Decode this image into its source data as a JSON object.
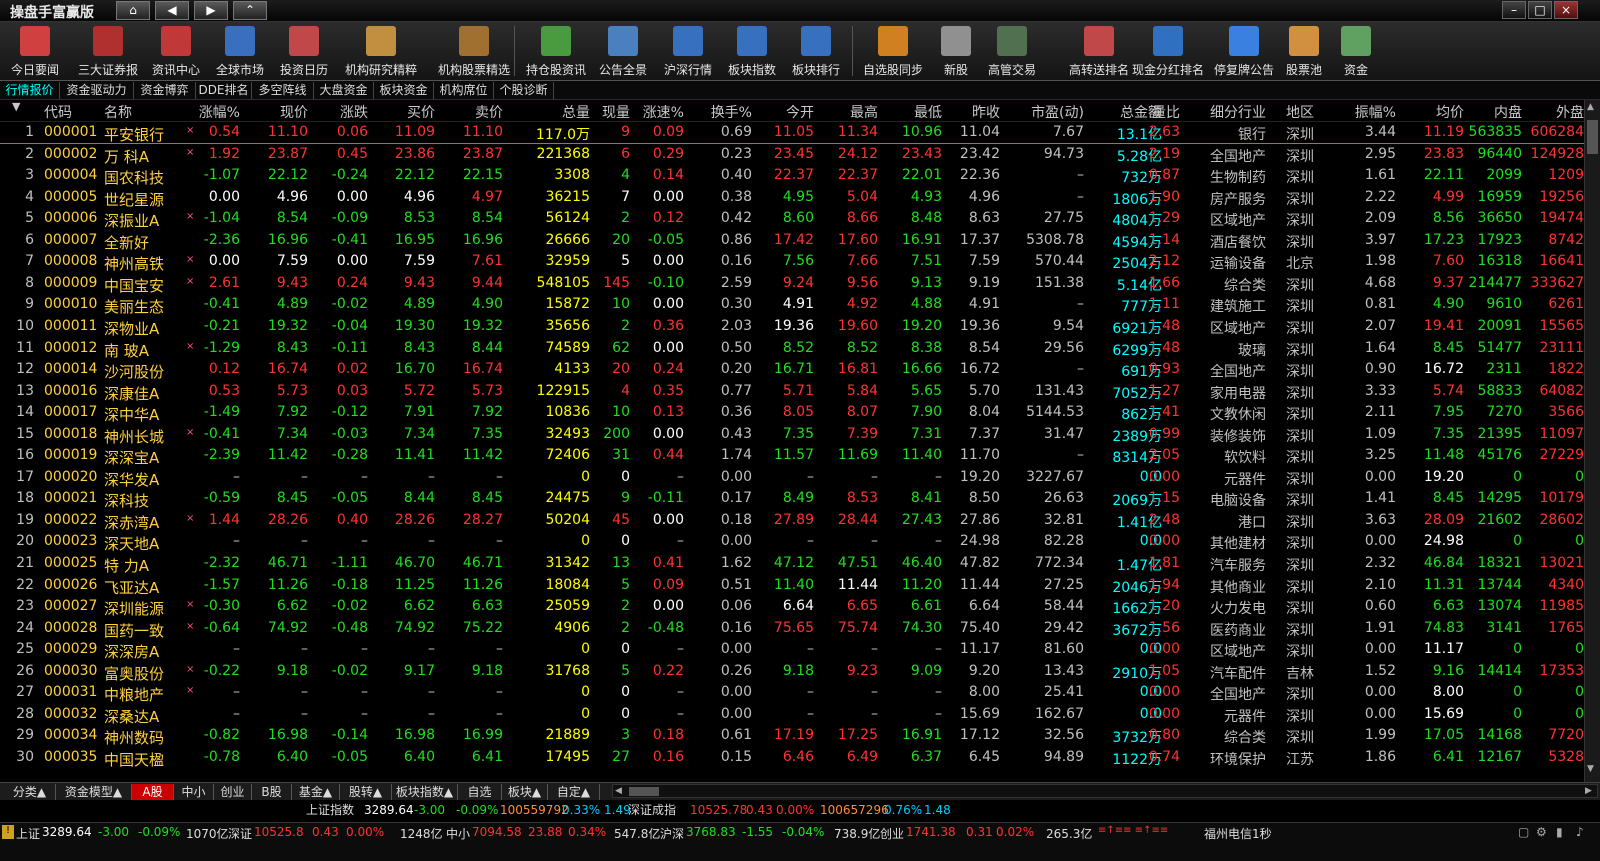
{
  "app": {
    "title": "操盘手富赢版",
    "nav": [
      "home-icon",
      "back-icon",
      "forward-icon",
      "top-icon"
    ],
    "window_buttons": [
      "–",
      "□",
      "×"
    ]
  },
  "toolbar": [
    {
      "label": "今日要闻",
      "icon": "news-today-icon",
      "color": "#d04040"
    },
    {
      "label": "三大证券报",
      "icon": "newspaper-icon",
      "color": "#b03030"
    },
    {
      "label": "资讯中心",
      "icon": "news-center-icon",
      "color": "#c03838"
    },
    {
      "label": "全球市场",
      "icon": "globe-icon",
      "color": "#3a6fc0"
    },
    {
      "label": "投资日历",
      "icon": "calendar-icon",
      "color": "#c04848"
    },
    {
      "label": "机构研究精粹",
      "icon": "document-icon",
      "color": "#c09040"
    },
    {
      "label": "机构股票精选",
      "icon": "printer-icon",
      "color": "#a07030"
    },
    {
      "label": "持仓股资讯",
      "icon": "hand-money-icon",
      "color": "#4a9a40"
    },
    {
      "label": "公告全景",
      "icon": "megaphone-icon",
      "color": "#4a80c0"
    },
    {
      "label": "沪深行情",
      "icon": "market-chart-icon",
      "color": "#3870c0"
    },
    {
      "label": "板块指数",
      "icon": "sector-index-icon",
      "color": "#3870c0"
    },
    {
      "label": "板块排行",
      "icon": "sector-rank-icon",
      "color": "#3870c0"
    },
    {
      "label": "自选股同步",
      "icon": "sync-icon",
      "color": "#d08020"
    },
    {
      "label": "新股",
      "icon": "new-stock-icon",
      "color": "#909090"
    },
    {
      "label": "高管交易",
      "icon": "executive-trade-icon",
      "color": "#507050"
    },
    {
      "label": "高转送排名",
      "icon": "ranking-calendar-icon",
      "color": "#c04848"
    },
    {
      "label": "现金分红排名",
      "icon": "bar-chart-icon",
      "color": "#3070c0"
    },
    {
      "label": "停复牌公告",
      "icon": "speech-bubble-icon",
      "color": "#3a80e0"
    },
    {
      "label": "股票池",
      "icon": "user-pool-icon",
      "color": "#d09040"
    },
    {
      "label": "资金",
      "icon": "funds-icon",
      "color": "#60a060"
    }
  ],
  "tabs": [
    "行情报价",
    "资金驱动力",
    "资金博弈",
    "DDE排名",
    "多空阵线",
    "大盘资金",
    "板块资金",
    "机构席位",
    "个股诊断"
  ],
  "headers": [
    "代码",
    "名称",
    "涨幅%",
    "现价",
    "涨跌",
    "买价",
    "卖价",
    "总量",
    "现量",
    "涨速%",
    "换手%",
    "今开",
    "最高",
    "最低",
    "昨收",
    "市盈(动)",
    "总金额",
    "量比",
    "细分行业",
    "地区",
    "振幅%",
    "均价",
    "内盘",
    "外盘"
  ],
  "rows": [
    [
      "1",
      "000001",
      "平安银行",
      "×",
      "0.54",
      "11.10",
      "0.06",
      "11.09",
      "11.10",
      "117.0万",
      "9",
      "0.09",
      "0.69",
      "11.05",
      "11.34",
      "10.96",
      "11.04",
      "7.67",
      "13.1亿",
      "2.63",
      "银行",
      "深圳",
      "3.44",
      "11.19",
      "563835",
      "606284"
    ],
    [
      "2",
      "000002",
      "万 科A",
      "×",
      "1.92",
      "23.87",
      "0.45",
      "23.86",
      "23.87",
      "221368",
      "6",
      "0.29",
      "0.23",
      "23.45",
      "24.12",
      "23.43",
      "23.42",
      "94.73",
      "5.28亿",
      "2.19",
      "全国地产",
      "深圳",
      "2.95",
      "23.83",
      "96440",
      "124928"
    ],
    [
      "3",
      "000004",
      "国农科技",
      "",
      "-1.07",
      "22.12",
      "-0.24",
      "22.12",
      "22.15",
      "3308",
      "4",
      "0.14",
      "0.40",
      "22.37",
      "22.37",
      "22.01",
      "22.36",
      "–",
      "732万",
      "0.87",
      "生物制药",
      "深圳",
      "1.61",
      "22.11",
      "2099",
      "1209"
    ],
    [
      "4",
      "000005",
      "世纪星源",
      "",
      "0.00",
      "4.96",
      "0.00",
      "4.96",
      "4.97",
      "36215",
      "7",
      "0.00",
      "0.38",
      "4.95",
      "5.04",
      "4.93",
      "4.96",
      "–",
      "1806万",
      "1.90",
      "房产服务",
      "深圳",
      "2.22",
      "4.99",
      "16959",
      "19256"
    ],
    [
      "5",
      "000006",
      "深振业A",
      "×",
      "-1.04",
      "8.54",
      "-0.09",
      "8.53",
      "8.54",
      "56124",
      "2",
      "0.12",
      "0.42",
      "8.60",
      "8.66",
      "8.48",
      "8.63",
      "27.75",
      "4804万",
      "1.29",
      "区域地产",
      "深圳",
      "2.09",
      "8.56",
      "36650",
      "19474"
    ],
    [
      "6",
      "000007",
      "全新好",
      "",
      "-2.36",
      "16.96",
      "-0.41",
      "16.95",
      "16.96",
      "26666",
      "20",
      "-0.05",
      "0.86",
      "17.42",
      "17.60",
      "16.91",
      "17.37",
      "5308.78",
      "4594万",
      "1.14",
      "酒店餐饮",
      "深圳",
      "3.97",
      "17.23",
      "17923",
      "8742"
    ],
    [
      "7",
      "000008",
      "神州高铁",
      "×",
      "0.00",
      "7.59",
      "0.00",
      "7.59",
      "7.61",
      "32959",
      "5",
      "0.00",
      "0.16",
      "7.56",
      "7.66",
      "7.51",
      "7.59",
      "570.44",
      "2504万",
      "2.12",
      "运输设备",
      "北京",
      "1.98",
      "7.60",
      "16318",
      "16641"
    ],
    [
      "8",
      "000009",
      "中国宝安",
      "×",
      "2.61",
      "9.43",
      "0.24",
      "9.43",
      "9.44",
      "548105",
      "145",
      "-0.10",
      "2.59",
      "9.24",
      "9.56",
      "9.13",
      "9.19",
      "151.38",
      "5.14亿",
      "1.66",
      "综合类",
      "深圳",
      "4.68",
      "9.37",
      "214477",
      "333627"
    ],
    [
      "9",
      "000010",
      "美丽生态",
      "",
      "-0.41",
      "4.89",
      "-0.02",
      "4.89",
      "4.90",
      "15872",
      "10",
      "0.00",
      "0.30",
      "4.91",
      "4.92",
      "4.88",
      "4.91",
      "–",
      "777万",
      "1.11",
      "建筑施工",
      "深圳",
      "0.81",
      "4.90",
      "9610",
      "6261"
    ],
    [
      "10",
      "000011",
      "深物业A",
      "",
      "-0.21",
      "19.32",
      "-0.04",
      "19.30",
      "19.32",
      "35656",
      "2",
      "0.36",
      "2.03",
      "19.36",
      "19.60",
      "19.20",
      "19.36",
      "9.54",
      "6921万",
      "1.48",
      "区域地产",
      "深圳",
      "2.07",
      "19.41",
      "20091",
      "15565"
    ],
    [
      "11",
      "000012",
      "南 玻A",
      "×",
      "-1.29",
      "8.43",
      "-0.11",
      "8.43",
      "8.44",
      "74589",
      "62",
      "0.00",
      "0.50",
      "8.52",
      "8.52",
      "8.38",
      "8.54",
      "29.56",
      "6299万",
      "1.48",
      "玻璃",
      "深圳",
      "1.64",
      "8.45",
      "51477",
      "23111"
    ],
    [
      "12",
      "000014",
      "沙河股份",
      "",
      "0.12",
      "16.74",
      "0.02",
      "16.70",
      "16.74",
      "4133",
      "20",
      "0.24",
      "0.20",
      "16.71",
      "16.81",
      "16.66",
      "16.72",
      "–",
      "691万",
      "0.93",
      "全国地产",
      "深圳",
      "0.90",
      "16.72",
      "2311",
      "1822"
    ],
    [
      "13",
      "000016",
      "深康佳A",
      "",
      "0.53",
      "5.73",
      "0.03",
      "5.72",
      "5.73",
      "122915",
      "4",
      "0.35",
      "0.77",
      "5.71",
      "5.84",
      "5.65",
      "5.70",
      "131.43",
      "7052万",
      "1.27",
      "家用电器",
      "深圳",
      "3.33",
      "5.74",
      "58833",
      "64082"
    ],
    [
      "14",
      "000017",
      "深中华A",
      "",
      "-1.49",
      "7.92",
      "-0.12",
      "7.91",
      "7.92",
      "10836",
      "10",
      "0.13",
      "0.36",
      "8.05",
      "8.07",
      "7.90",
      "8.04",
      "5144.53",
      "862万",
      "1.41",
      "文教休闲",
      "深圳",
      "2.11",
      "7.95",
      "7270",
      "3566"
    ],
    [
      "15",
      "000018",
      "神州长城",
      "×",
      "-0.41",
      "7.34",
      "-0.03",
      "7.34",
      "7.35",
      "32493",
      "200",
      "0.00",
      "0.43",
      "7.35",
      "7.39",
      "7.31",
      "7.37",
      "31.47",
      "2389万",
      "0.99",
      "装修装饰",
      "深圳",
      "1.09",
      "7.35",
      "21395",
      "11097"
    ],
    [
      "16",
      "000019",
      "深深宝A",
      "",
      "-2.39",
      "11.42",
      "-0.28",
      "11.41",
      "11.42",
      "72406",
      "31",
      "0.44",
      "1.74",
      "11.57",
      "11.69",
      "11.40",
      "11.70",
      "–",
      "8314万",
      "2.05",
      "软饮料",
      "深圳",
      "3.25",
      "11.48",
      "45176",
      "27229"
    ],
    [
      "17",
      "000020",
      "深华发A",
      "",
      "–",
      "–",
      "–",
      "–",
      "–",
      "0",
      "0",
      "–",
      "0.00",
      "–",
      "–",
      "–",
      "19.20",
      "3227.67",
      "0.0",
      "0.00",
      "元器件",
      "深圳",
      "0.00",
      "19.20",
      "0",
      "0"
    ],
    [
      "18",
      "000021",
      "深科技",
      "",
      "-0.59",
      "8.45",
      "-0.05",
      "8.44",
      "8.45",
      "24475",
      "9",
      "-0.11",
      "0.17",
      "8.49",
      "8.53",
      "8.41",
      "8.50",
      "26.63",
      "2069万",
      "1.15",
      "电脑设备",
      "深圳",
      "1.41",
      "8.45",
      "14295",
      "10179"
    ],
    [
      "19",
      "000022",
      "深赤湾A",
      "×",
      "1.44",
      "28.26",
      "0.40",
      "28.26",
      "28.27",
      "50204",
      "45",
      "0.00",
      "0.18",
      "27.89",
      "28.44",
      "27.43",
      "27.86",
      "32.81",
      "1.41亿",
      "2.48",
      "港口",
      "深圳",
      "3.63",
      "28.09",
      "21602",
      "28602"
    ],
    [
      "20",
      "000023",
      "深天地A",
      "",
      "–",
      "–",
      "–",
      "–",
      "–",
      "0",
      "0",
      "–",
      "0.00",
      "–",
      "–",
      "–",
      "24.98",
      "82.28",
      "0.0",
      "0.00",
      "其他建材",
      "深圳",
      "0.00",
      "24.98",
      "0",
      "0"
    ],
    [
      "21",
      "000025",
      "特 力A",
      "",
      "-2.32",
      "46.71",
      "-1.11",
      "46.70",
      "46.71",
      "31342",
      "13",
      "0.41",
      "1.62",
      "47.12",
      "47.51",
      "46.40",
      "47.82",
      "772.34",
      "1.47亿",
      "1.81",
      "汽车服务",
      "深圳",
      "2.32",
      "46.84",
      "18321",
      "13021"
    ],
    [
      "22",
      "000026",
      "飞亚达A",
      "",
      "-1.57",
      "11.26",
      "-0.18",
      "11.25",
      "11.26",
      "18084",
      "5",
      "0.09",
      "0.51",
      "11.40",
      "11.44",
      "11.20",
      "11.44",
      "27.25",
      "2046万",
      "1.94",
      "其他商业",
      "深圳",
      "2.10",
      "11.31",
      "13744",
      "4340"
    ],
    [
      "23",
      "000027",
      "深圳能源",
      "×",
      "-0.30",
      "6.62",
      "-0.02",
      "6.62",
      "6.63",
      "25059",
      "2",
      "0.00",
      "0.06",
      "6.64",
      "6.65",
      "6.61",
      "6.64",
      "58.44",
      "1662万",
      "1.20",
      "火力发电",
      "深圳",
      "0.60",
      "6.63",
      "13074",
      "11985"
    ],
    [
      "24",
      "000028",
      "国药一致",
      "×",
      "-0.64",
      "74.92",
      "-0.48",
      "74.92",
      "75.22",
      "4906",
      "2",
      "-0.48",
      "0.16",
      "75.65",
      "75.74",
      "74.30",
      "75.40",
      "29.42",
      "3672万",
      "1.56",
      "医药商业",
      "深圳",
      "1.91",
      "74.83",
      "3141",
      "1765"
    ],
    [
      "25",
      "000029",
      "深深房A",
      "",
      "–",
      "–",
      "–",
      "–",
      "–",
      "0",
      "0",
      "–",
      "0.00",
      "–",
      "–",
      "–",
      "11.17",
      "81.60",
      "0.0",
      "0.00",
      "区域地产",
      "深圳",
      "0.00",
      "11.17",
      "0",
      "0"
    ],
    [
      "26",
      "000030",
      "富奥股份",
      "×",
      "-0.22",
      "9.18",
      "-0.02",
      "9.17",
      "9.18",
      "31768",
      "5",
      "0.22",
      "0.26",
      "9.18",
      "9.23",
      "9.09",
      "9.20",
      "13.43",
      "2910万",
      "1.05",
      "汽车配件",
      "吉林",
      "1.52",
      "9.16",
      "14414",
      "17353"
    ],
    [
      "27",
      "000031",
      "中粮地产",
      "×",
      "–",
      "–",
      "–",
      "–",
      "–",
      "0",
      "0",
      "–",
      "0.00",
      "–",
      "–",
      "–",
      "8.00",
      "25.41",
      "0.0",
      "0.00",
      "全国地产",
      "深圳",
      "0.00",
      "8.00",
      "0",
      "0"
    ],
    [
      "28",
      "000032",
      "深桑达A",
      "",
      "–",
      "–",
      "–",
      "–",
      "–",
      "0",
      "0",
      "–",
      "0.00",
      "–",
      "–",
      "–",
      "15.69",
      "162.67",
      "0.0",
      "0.00",
      "元器件",
      "深圳",
      "0.00",
      "15.69",
      "0",
      "0"
    ],
    [
      "29",
      "000034",
      "神州数码",
      "",
      "-0.82",
      "16.98",
      "-0.14",
      "16.98",
      "16.99",
      "21889",
      "3",
      "0.18",
      "0.61",
      "17.19",
      "17.25",
      "16.91",
      "17.12",
      "32.56",
      "3732万",
      "0.80",
      "综合类",
      "深圳",
      "1.99",
      "17.05",
      "14168",
      "7720"
    ],
    [
      "30",
      "000035",
      "中国天楹",
      "",
      "-0.78",
      "6.40",
      "-0.05",
      "6.40",
      "6.41",
      "17495",
      "27",
      "0.16",
      "0.15",
      "6.46",
      "6.49",
      "6.37",
      "6.45",
      "94.89",
      "1122万",
      "0.74",
      "环境保护",
      "江苏",
      "1.86",
      "6.41",
      "12167",
      "5328"
    ]
  ],
  "bottom_tabs": [
    "分类▲",
    "资金模型▲",
    "A股",
    "中小",
    "创业",
    "B股",
    "基金▲",
    "股转▲",
    "板块指数▲",
    "自选",
    "板块▲",
    "自定▲"
  ],
  "index_line": {
    "name1": "上证指数",
    "v1": "3289.64",
    "c1": "-3.00",
    "p1": "-0.09%",
    "vol1": "100559792",
    "r1": "0.33%",
    "x1": "1.49",
    "name2": "深证成指",
    "v2": "10525.78",
    "c2": "0.43",
    "p2": "0.00%",
    "vol2": "100657296",
    "r2": "0.76%",
    "x2": "1.48"
  },
  "status": {
    "sh_name": "上证",
    "sh_val": "3289.64",
    "sh_chg": "-3.00",
    "sh_pct": "-0.09%",
    "sh_amt": "1070亿",
    "sz_name": "深证",
    "sz_val": "10525.8",
    "sz_chg": "0.43",
    "sz_pct": "0.00%",
    "sz_amt": "1248亿",
    "zx_name": "中小",
    "zx_val": "7094.58",
    "zx_chg": "23.88",
    "zx_pct": "0.34%",
    "zx_amt": "547.8亿",
    "hs_name": "沪深",
    "hs_val": "3768.83",
    "hs_chg": "-1.55",
    "hs_pct": "-0.04%",
    "hs_amt": "738.9亿",
    "cy_name": "创业",
    "cy_val": "1741.38",
    "cy_chg": "0.31",
    "cy_pct": "0.02%",
    "cy_amt": "265.3亿",
    "server": "福州电信1秒"
  }
}
